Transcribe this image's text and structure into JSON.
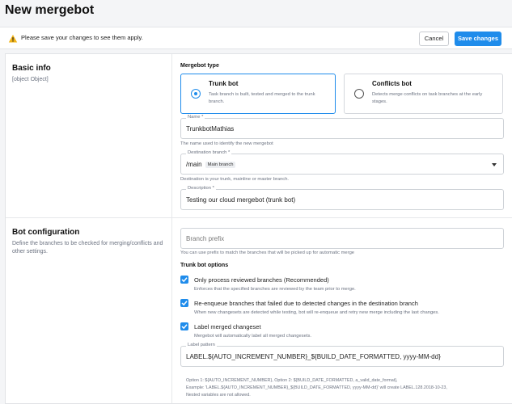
{
  "page": {
    "title": "New mergebot"
  },
  "warning": {
    "text": "Please save your changes to see them apply.",
    "cancel_label": "Cancel",
    "save_label": "Save changes",
    "icon": "warning-icon"
  },
  "colors": {
    "accent": "#1f8ceb",
    "warning": "#f2b417"
  },
  "basic_info": {
    "title": "Basic info",
    "description": {
      "label": "Description *",
      "value": "Testing our cloud mergebot (trunk bot)"
    },
    "mergebot_type_label": "Mergebot type",
    "types": [
      {
        "title": "Trunk bot",
        "description": "Task branch is built, tested and merged to the trunk branch.",
        "selected": true
      },
      {
        "title": "Conflicts bot",
        "description": "Detects merge conflicts on task branches at the early stages.",
        "selected": false
      }
    ],
    "name": {
      "label": "Name *",
      "value": "TrunkbotMathias",
      "helper": "The name used to identify the new mergebot"
    },
    "destination": {
      "label": "Destination branch *",
      "value": "/main",
      "chip": "Main branch",
      "helper": "Destination is your trunk, mainline or master branch."
    }
  },
  "bot_config": {
    "title": "Bot configuration",
    "description": "Define the branches to be checked for merging/conflicts and other settings.",
    "branch_prefix": {
      "placeholder": "Branch prefix",
      "helper": "You can use prefix to match the branches that will be picked up for automatic merge"
    },
    "options_label": "Trunk bot options",
    "options": [
      {
        "label": "Only process reviewed branches (Recommended)",
        "description": "Enforces that the specified branches are reviewed by the team prior to merge.",
        "checked": true
      },
      {
        "label": "Re-enqueue branches that failed due to detected changes in the destination branch",
        "description": "When new changesets are detected while testing, bot will re-enqueue and retry new merge including the last changes.",
        "checked": true
      },
      {
        "label": "Label merged changeset",
        "description": "Mergebot will automatically label all merged changesets.",
        "checked": true
      }
    ],
    "label_pattern": {
      "label": "Label pattern",
      "value": "LABEL.${AUTO_INCREMENT_NUMBER}_${BUILD_DATE_FORMATTED, yyyy-MM-dd}"
    },
    "footnote": [
      "Option 1: ${AUTO_INCREMENT_NUMBER}, Option 2: ${BUILD_DATE_FORMATTED, a_valid_date_format},",
      "Example: 'LABEL.${AUTO_INCREMENT_NUMBER}_${BUILD_DATE_FORMATTED, yyyy-MM-dd}' will create LABEL.128.2018-10-23,",
      "Nested variables are not allowed."
    ]
  }
}
